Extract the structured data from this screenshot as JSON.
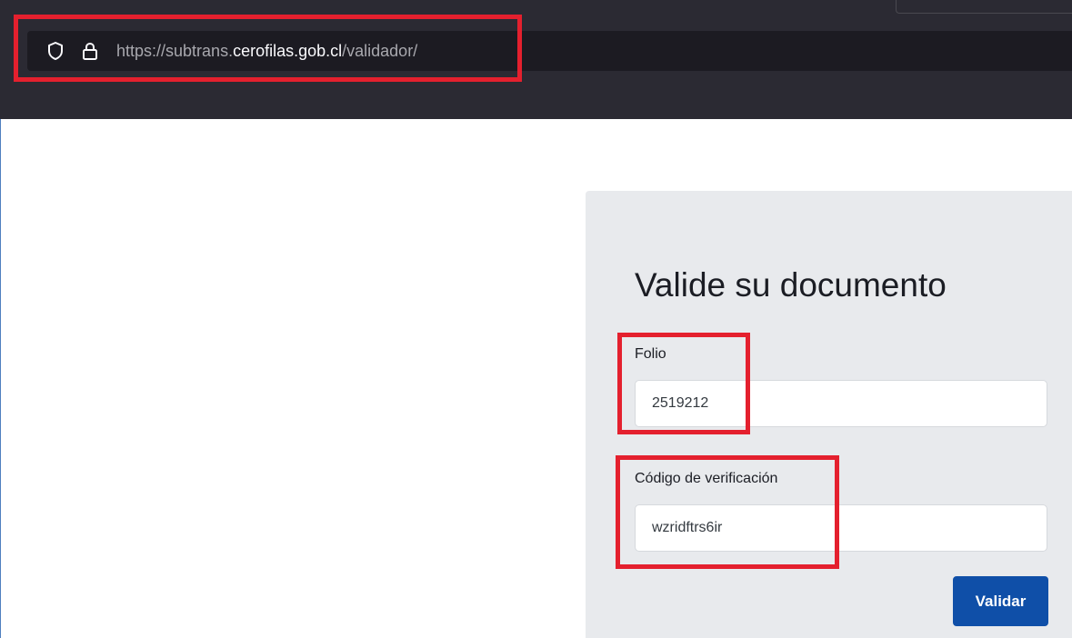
{
  "browser": {
    "url_prefix": "https://subtrans.",
    "url_domain": "cerofilas.gob.cl",
    "url_path": "/validador/",
    "icons": [
      "shield-icon",
      "lock-icon"
    ]
  },
  "form": {
    "title": "Valide su documento",
    "folio_label": "Folio",
    "folio_value": "2519212",
    "code_label": "Código de verificación",
    "code_value": "wzridftrs6ir",
    "submit_label": "Validar"
  },
  "colors": {
    "browser_chrome": "#2b2a33",
    "url_bar": "#1c1b22",
    "card_background": "#e8eaed",
    "button": "#0f4fa8",
    "highlight": "#e4202e"
  }
}
